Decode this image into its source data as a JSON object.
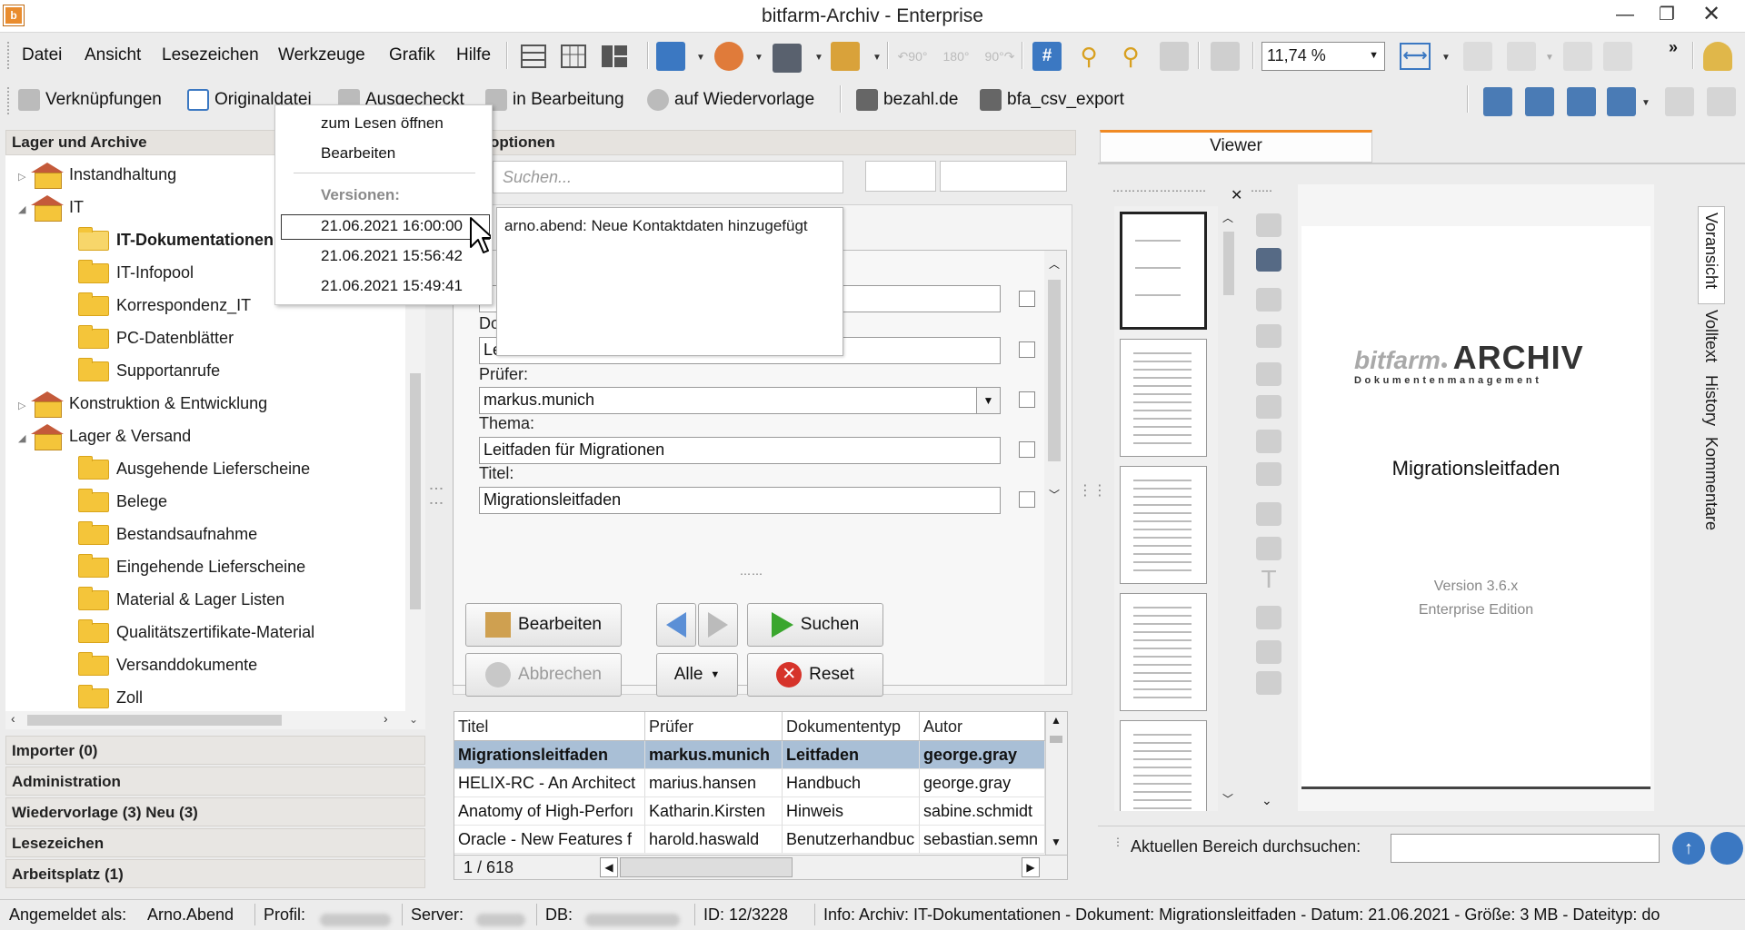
{
  "window": {
    "title": "bitfarm-Archiv - Enterprise",
    "app_icon": "bitfarm-logo-icon"
  },
  "menu": [
    "Datei",
    "Ansicht",
    "Lesezeichen",
    "Werkzeuge",
    "Grafik",
    "Hilfe"
  ],
  "zoom": "11,74 %",
  "toolbar2": {
    "items": [
      "Verknüpfungen",
      "Originaldatei",
      "Ausgecheckt",
      "in Bearbeitung",
      "auf Wiedervorlage",
      "bezahl.de",
      "bfa_csv_export"
    ]
  },
  "left": {
    "header": "Lager und Archive",
    "tree": [
      {
        "label": "Instandhaltung",
        "type": "house",
        "level": 0,
        "expander": "collapsed"
      },
      {
        "label": "IT",
        "type": "house",
        "level": 0,
        "expander": "expanded"
      },
      {
        "label": "IT-Dokumentationen",
        "type": "folder-open",
        "level": 1,
        "selected": true
      },
      {
        "label": "IT-Infopool",
        "type": "folder",
        "level": 1
      },
      {
        "label": "Korrespondenz_IT",
        "type": "folder",
        "level": 1
      },
      {
        "label": "PC-Datenblätter",
        "type": "folder",
        "level": 1
      },
      {
        "label": "Supportanrufe",
        "type": "folder",
        "level": 1
      },
      {
        "label": "Konstruktion & Entwicklung",
        "type": "house",
        "level": 0,
        "expander": "collapsed"
      },
      {
        "label": "Lager & Versand",
        "type": "house",
        "level": 0,
        "expander": "expanded"
      },
      {
        "label": "Ausgehende Lieferscheine",
        "type": "folder",
        "level": 1
      },
      {
        "label": "Belege",
        "type": "folder",
        "level": 1
      },
      {
        "label": "Bestandsaufnahme",
        "type": "folder",
        "level": 1
      },
      {
        "label": "Eingehende Lieferscheine",
        "type": "folder",
        "level": 1
      },
      {
        "label": "Material & Lager Listen",
        "type": "folder",
        "level": 1
      },
      {
        "label": "Qualitätszertifikate-Material",
        "type": "folder",
        "level": 1
      },
      {
        "label": "Versanddokumente",
        "type": "folder",
        "level": 1
      },
      {
        "label": "Zoll",
        "type": "folder",
        "level": 1
      }
    ],
    "accordion": [
      "Importer (0)",
      "Administration",
      "Wiedervorlage (3)  Neu (3)",
      "Lesezeichen",
      "Arbeitsplatz (1)"
    ]
  },
  "center": {
    "header": "optionen",
    "search_placeholder": "Suchen...",
    "fields": [
      {
        "label": "Do",
        "value": "Leitfaden"
      },
      {
        "label": "Prüfer:",
        "value": "markus.munich"
      },
      {
        "label": "Thema:",
        "value": "Leitfaden für Migrationen"
      },
      {
        "label": "Titel:",
        "value": "Migrationsleitfaden"
      }
    ],
    "buttons": {
      "edit": "Bearbeiten",
      "cancel": "Abbrechen",
      "search": "Suchen",
      "all": "Alle",
      "reset": "Reset"
    },
    "table": {
      "columns": [
        "Titel",
        "Prüfer",
        "Dokumententyp",
        "Autor"
      ],
      "rows": [
        [
          "Migrationsleitfaden",
          "markus.munich",
          "Leitfaden",
          "george.gray"
        ],
        [
          "HELIX-RC - An Architect",
          "marius.hansen",
          "Handbuch",
          "george.gray"
        ],
        [
          "Anatomy of High-Perforı",
          "Katharin.Kirsten",
          "Hinweis",
          "sabine.schmidt"
        ],
        [
          "Oracle - New Features f",
          "harold.haswald",
          "Benutzerhandbuc",
          "sebastian.semn"
        ]
      ],
      "pager": "1 / 618"
    }
  },
  "context_menu": {
    "open_read": "zum Lesen öffnen",
    "edit": "Bearbeiten",
    "versions_label": "Versionen:",
    "versions": [
      "21.06.2021 16:00:00",
      "21.06.2021 15:56:42",
      "21.06.2021 15:49:41"
    ]
  },
  "tooltip": "arno.abend: Neue Kontaktdaten hinzugefügt",
  "viewer": {
    "tab": "Viewer",
    "side_tabs": [
      "Voransicht",
      "Volltext",
      "History",
      "Kommentare"
    ],
    "doc": {
      "logo_prefix": "bitfarm",
      "logo_main": "ARCHIV",
      "logo_sub": "Dokumentenmanagement",
      "title": "Migrationsleitfaden",
      "version": "Version 3.6.x",
      "edition": "Enterprise Edition"
    },
    "search_label": "Aktuellen Bereich durchsuchen:"
  },
  "status": {
    "logged_label": "Angemeldet als:",
    "logged_user": "Arno.Abend",
    "profile_label": "Profil:",
    "server_label": "Server:",
    "db_label": "DB:",
    "id": "ID:  12/3228",
    "info": "Info:  Archiv: IT-Dokumentationen - Dokument: Migrationsleitfaden - Datum: 21.06.2021 - Größe: 3 MB - Dateityp: do"
  },
  "colors": {
    "accent": "#f08a24",
    "selection": "#a9bfd6",
    "folder": "#f4c53a",
    "reset_red": "#d6332a",
    "search_green": "#3aa62e",
    "nav_blue": "#5b8fd6"
  }
}
